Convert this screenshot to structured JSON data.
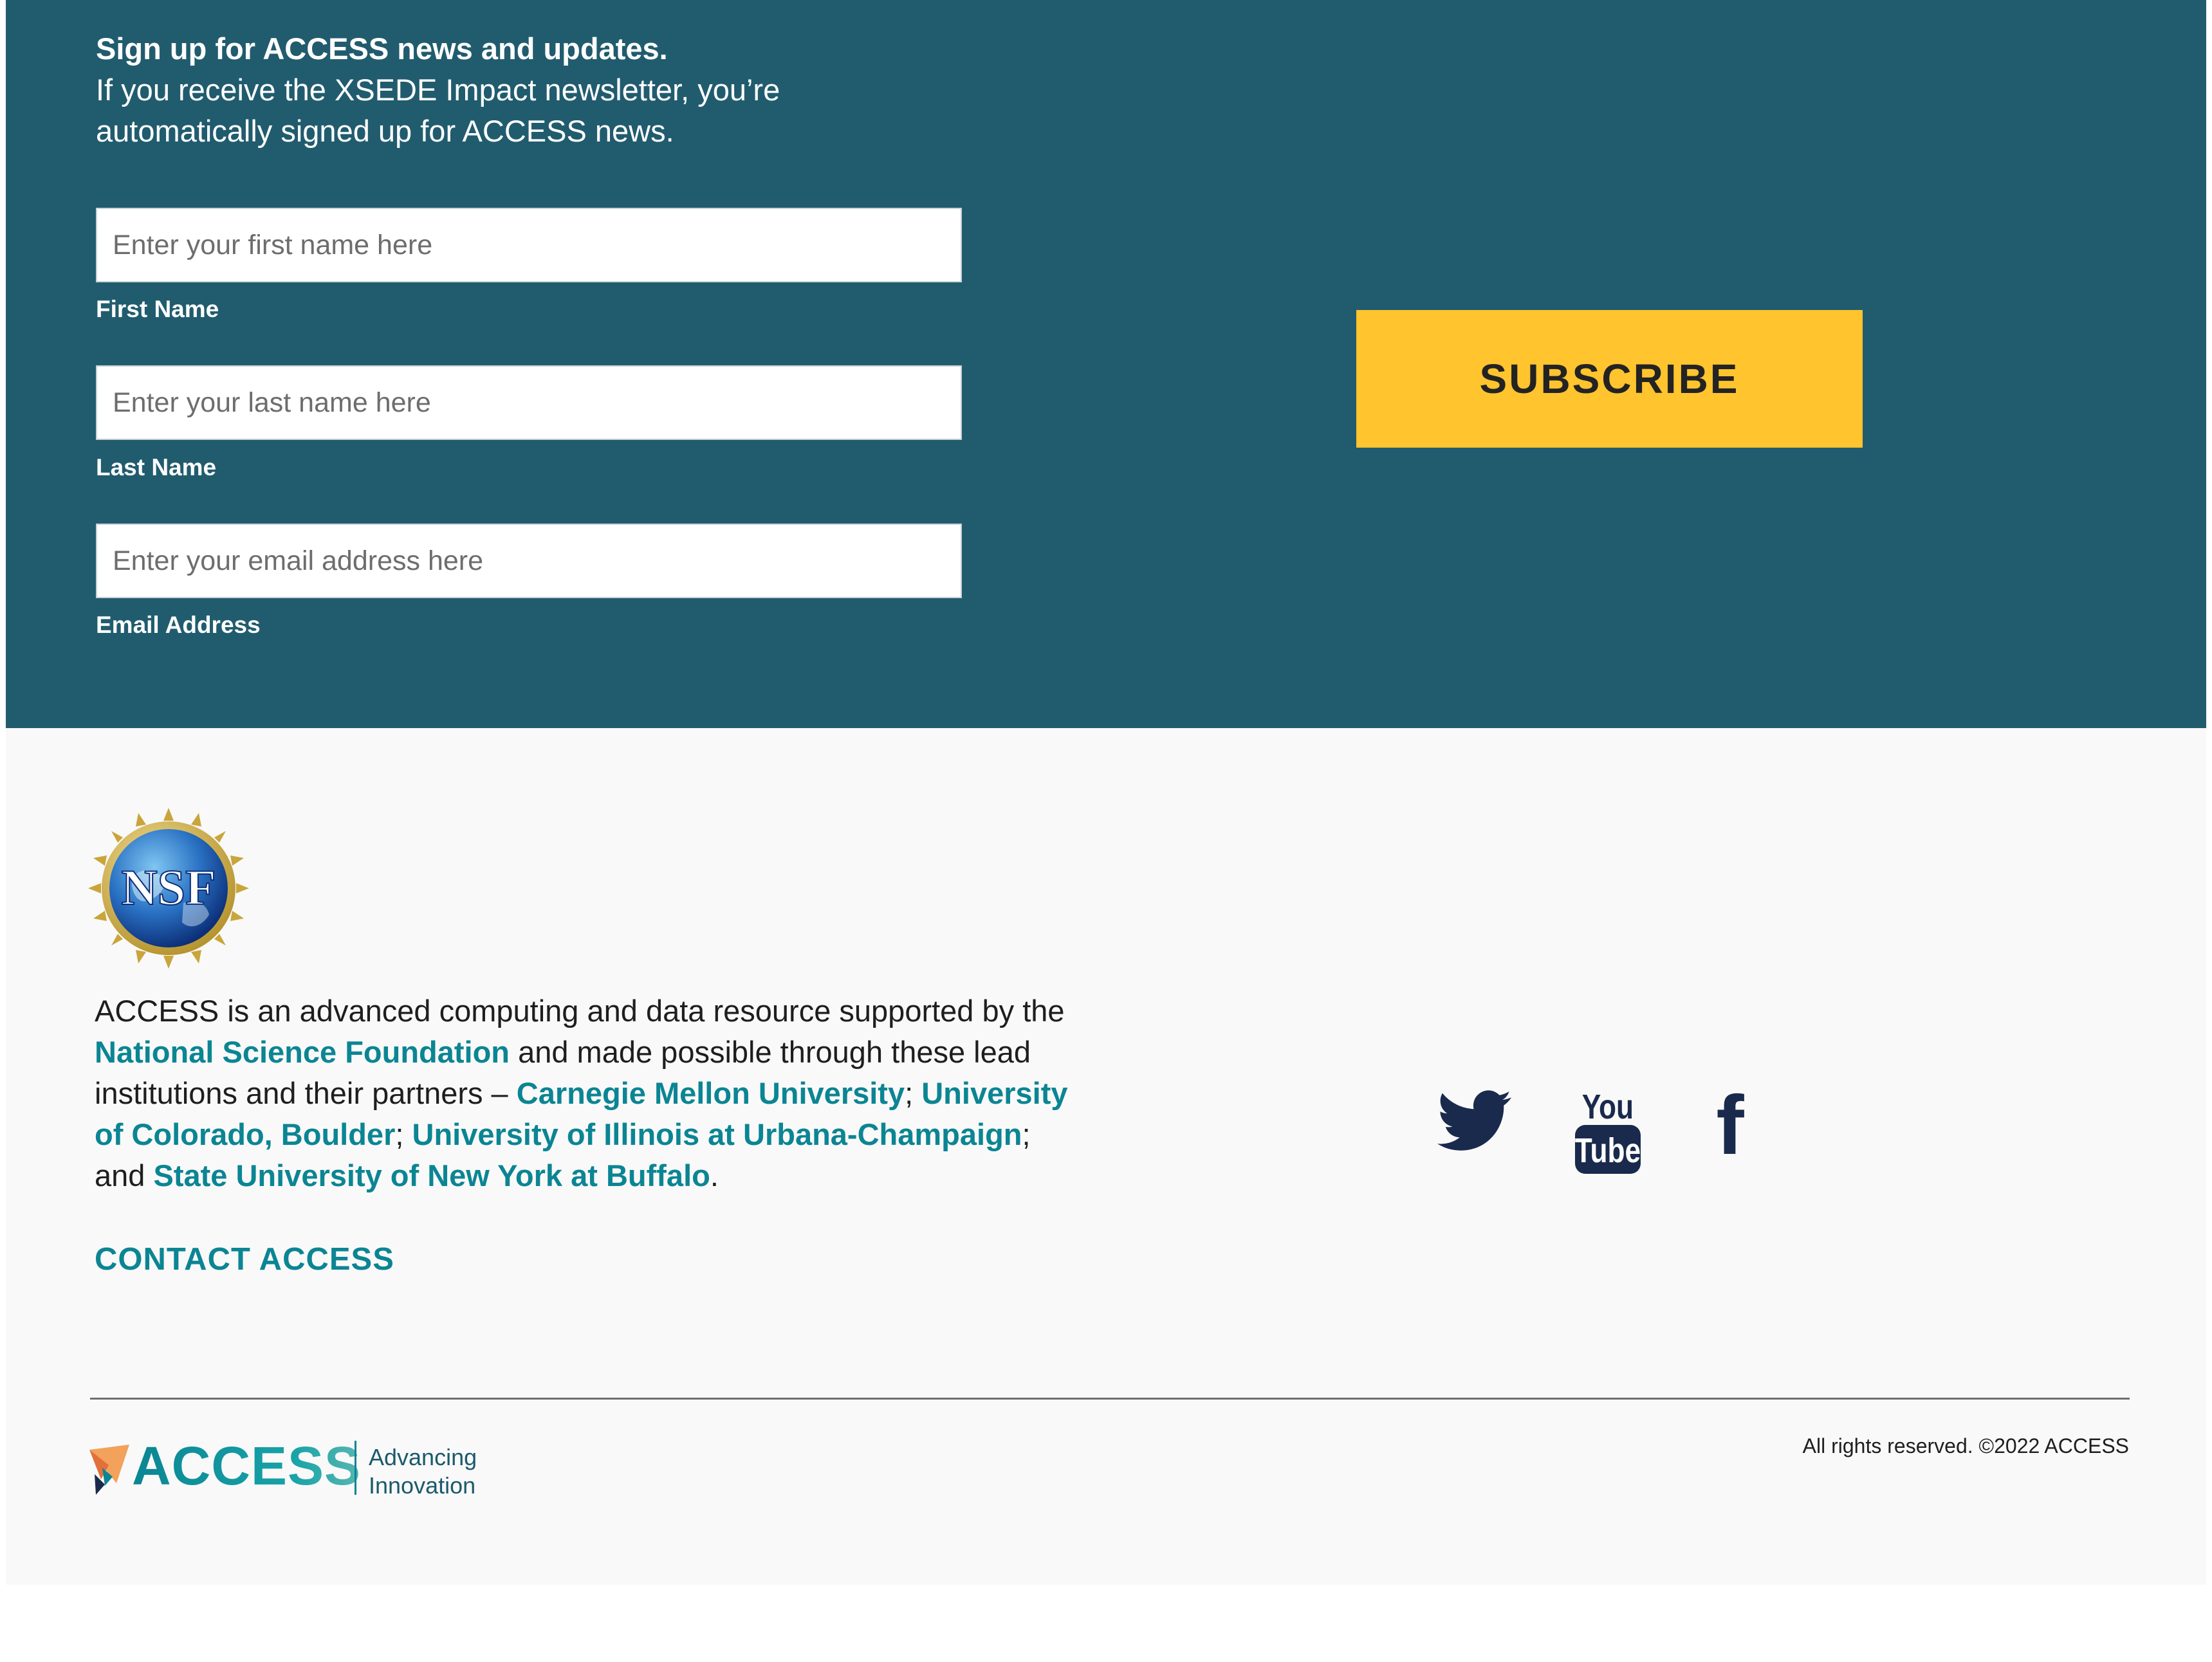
{
  "signup": {
    "heading": "Sign up for ACCESS news and updates.",
    "description": "If you receive the XSEDE Impact newsletter, you’re automatically signed up for ACCESS news.",
    "fields": [
      {
        "placeholder": "Enter your first name here",
        "value": "",
        "label": "First Name"
      },
      {
        "placeholder": "Enter your last name here",
        "value": "",
        "label": "Last Name"
      },
      {
        "placeholder": "Enter your email address here",
        "value": "",
        "label": "Email Address"
      }
    ],
    "subscribe_label": "SUBSCRIBE"
  },
  "footer": {
    "nsf_logo_text": "NSF",
    "about": {
      "t1": "ACCESS is an advanced computing and data resource supported by the ",
      "link_nsf": "National Science Foundation",
      "t2": " and made possible through these lead institutions and their partners – ",
      "link_cmu": "Carnegie Mellon University",
      "t3": "; ",
      "link_colorado": "University of Colorado, Boulder",
      "t4": "; ",
      "link_illinois": "University of Illinois at Urbana-Champaign",
      "t5": "; and ",
      "link_buffalo": "State University of New York at Buffalo",
      "t6": "."
    },
    "contact_label": "CONTACT ACCESS",
    "social": {
      "icons": [
        "twitter-icon",
        "youtube-icon",
        "facebook-icon"
      ],
      "youtube_text_top": "You",
      "youtube_text_bottom": "Tube",
      "facebook_glyph": "f"
    },
    "brand": {
      "name": "ACCESS",
      "tagline_line1": "Advancing",
      "tagline_line2": "Innovation"
    },
    "copyright": "All rights reserved. ©2022 ACCESS"
  },
  "colors": {
    "signup_bg": "#215c6e",
    "accent_yellow": "#ffc42e",
    "link_teal": "#0b8593",
    "icon_navy": "#1a2a4d",
    "footer_bg": "#f9f9f9"
  }
}
